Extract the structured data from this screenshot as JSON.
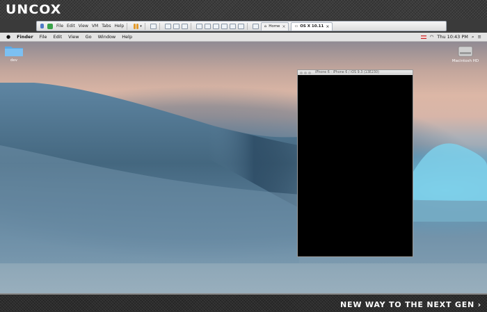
{
  "brand": {
    "logo": "UNCOX",
    "tagline": "NEW WAY TO THE NEXT GEN ›"
  },
  "vm_toolbar": {
    "menus": [
      "File",
      "Edit",
      "View",
      "VM",
      "Tabs",
      "Help"
    ],
    "tabs": [
      {
        "label": "Home",
        "active": false
      },
      {
        "label": "OS X 10.11",
        "active": true
      }
    ]
  },
  "mac_menubar": {
    "apple": "",
    "app": "Finder",
    "items": [
      "File",
      "Edit",
      "View",
      "Go",
      "Window",
      "Help"
    ],
    "clock": "Thu 10:43 PM"
  },
  "desktop": {
    "folder_label": "dev",
    "hd_label": "Macintosh HD"
  },
  "simulator": {
    "title": "iPhone 6 - iPhone 6 / iOS 9.3 (13E230)"
  },
  "colors": {
    "toolbar_accent": "#5b8fd6",
    "desktop_folder": "#5aa9e6"
  }
}
